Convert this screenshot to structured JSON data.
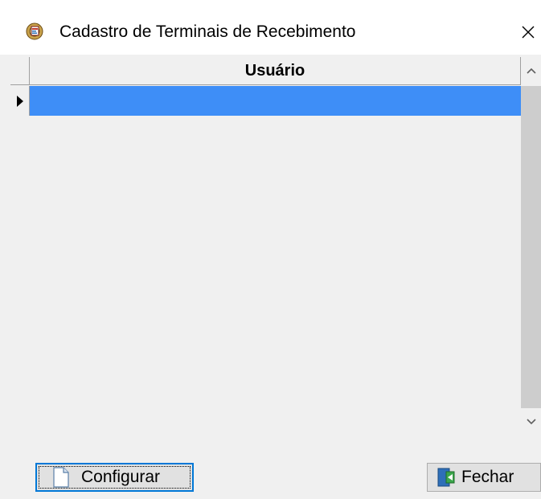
{
  "window": {
    "title": "Cadastro de Terminais de Recebimento",
    "app_icon": "registration-gear-icon",
    "close_icon": "close-icon"
  },
  "grid": {
    "columns": [
      "Usuário"
    ],
    "rows": [
      {
        "selected": true,
        "values": [
          ""
        ]
      }
    ],
    "row_indicator_icon": "current-row-arrow-icon",
    "selection_color": "#3e8ef7"
  },
  "buttons": {
    "configurar": {
      "label": "Configurar",
      "icon": "document-icon"
    },
    "fechar": {
      "label": "Fechar",
      "icon": "exit-door-icon"
    }
  }
}
